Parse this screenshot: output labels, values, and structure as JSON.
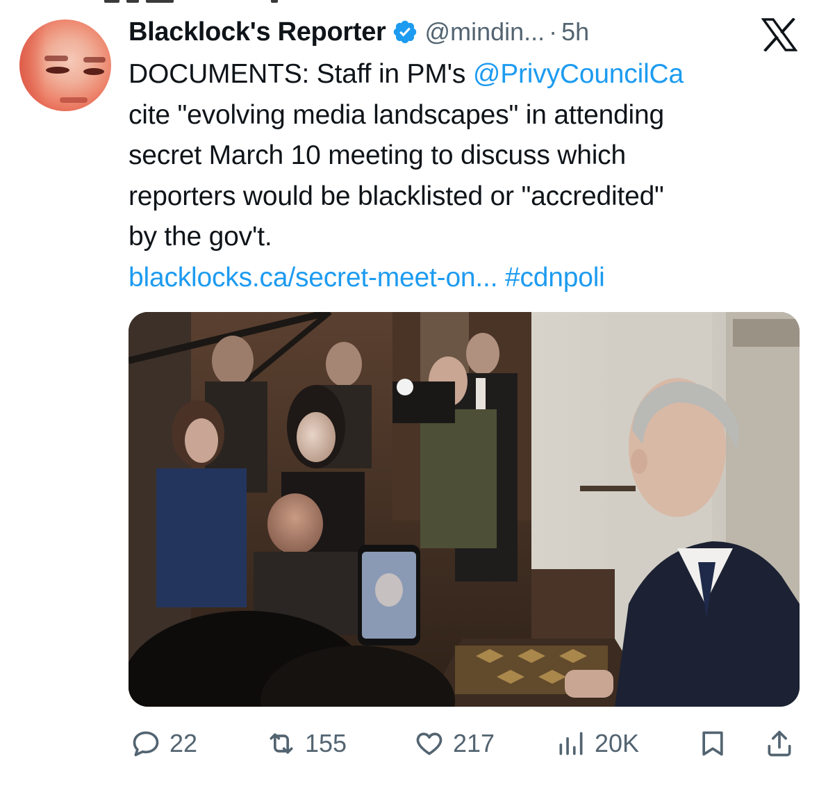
{
  "tweet": {
    "author": {
      "name": "Blacklock's Reporter",
      "handle": "@mindin...",
      "separator": "·",
      "time": "5h",
      "verified": true,
      "avatar": "avatar-portrait"
    },
    "body_lines": [
      {
        "prefix": "DOCUMENTS: Staff in PM's ",
        "mention": "@PrivyCouncilCa"
      },
      {
        "text": "cite \"evolving media landscapes\" in attending"
      },
      {
        "text": "secret March 10 meeting to discuss which"
      },
      {
        "text": "reporters would be blacklisted or \"accredited\""
      },
      {
        "text": "by the gov't."
      },
      {
        "url": "blacklocks.ca/secret-meet-on...",
        "hashtag": "#cdnpoli"
      }
    ],
    "media": {
      "type": "photo",
      "alt": "photo"
    },
    "actions": {
      "replies": "22",
      "reposts": "155",
      "likes": "217",
      "views": "20K"
    }
  },
  "icons": {
    "logo": "x-logo-icon",
    "verified": "verified-badge-icon",
    "reply": "reply-icon",
    "repost": "repost-icon",
    "like": "like-icon",
    "views": "views-icon",
    "bookmark": "bookmark-icon",
    "share": "share-icon"
  },
  "colors": {
    "text": "#0f1419",
    "secondary": "#536471",
    "link": "#1d9bf0",
    "verified": "#1d9bf0"
  }
}
